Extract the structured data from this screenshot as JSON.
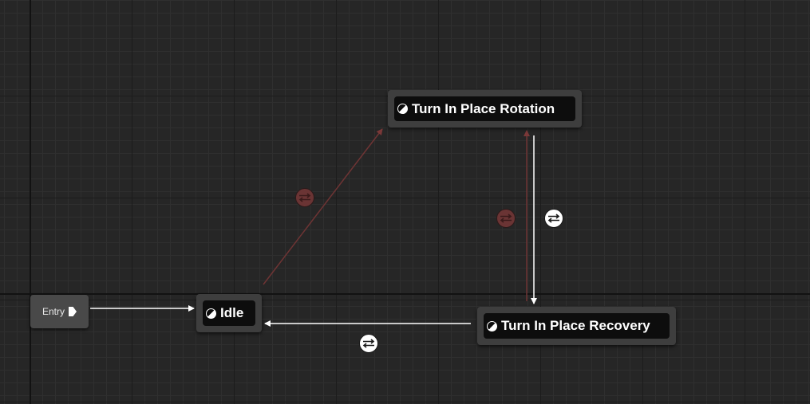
{
  "graph": {
    "entry": {
      "label": "Entry",
      "arrow_icon": "entry-arrow-icon"
    },
    "states": [
      {
        "key": "idle",
        "label": "Idle"
      },
      {
        "key": "turn_in_place_rotation",
        "label": "Turn In Place Rotation"
      },
      {
        "key": "turn_in_place_recovery",
        "label": "Turn In Place Recovery"
      }
    ],
    "transitions": [
      {
        "from": "Idle",
        "to": "Turn In Place Rotation",
        "status": "disabled"
      },
      {
        "from": "Turn In Place Rotation",
        "to": "Turn In Place Recovery",
        "status": "active"
      },
      {
        "from": "Turn In Place Recovery",
        "to": "Turn In Place Rotation",
        "status": "disabled"
      },
      {
        "from": "Turn In Place Recovery",
        "to": "Idle",
        "status": "active"
      }
    ],
    "colors": {
      "background": "#262626",
      "node_body": "#3e3e3e",
      "node_inner": "#0d0d0d",
      "active_wire": "#ffffff",
      "disabled_wire": "#6e3434"
    }
  }
}
